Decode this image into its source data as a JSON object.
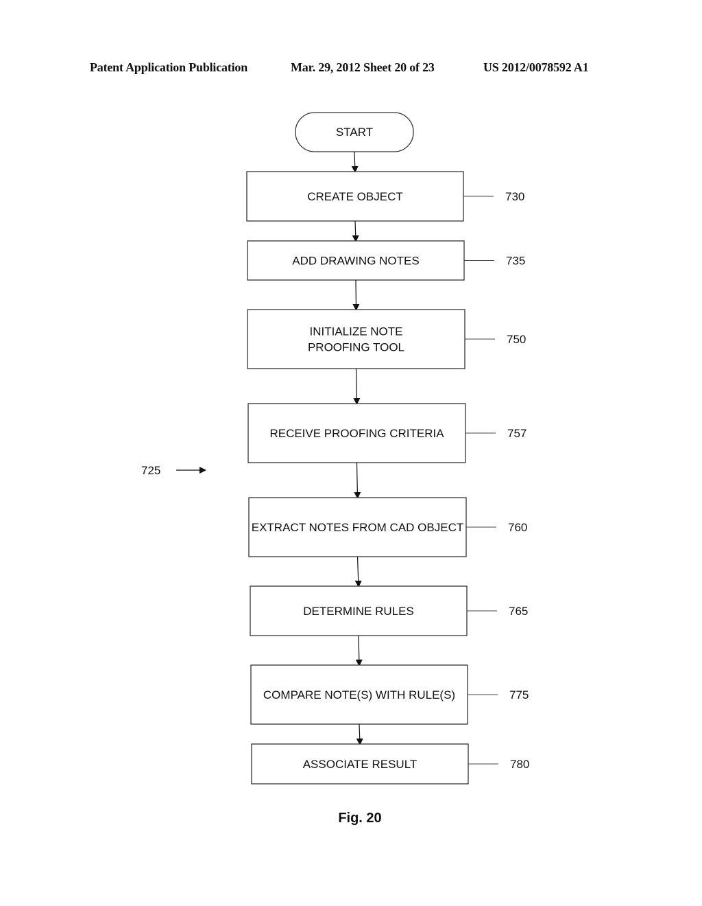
{
  "header": {
    "publication": "Patent Application Publication",
    "date_sheet": "Mar. 29, 2012  Sheet 20 of 23",
    "pub_number": "US 2012/0078592 A1"
  },
  "flowchart": {
    "start_label": "START",
    "steps": [
      {
        "lines": [
          "CREATE OBJECT"
        ],
        "ref": "730"
      },
      {
        "lines": [
          "ADD DRAWING NOTES"
        ],
        "ref": "735"
      },
      {
        "lines": [
          "INITIALIZE NOTE",
          "PROOFING TOOL"
        ],
        "ref": "750"
      },
      {
        "lines": [
          "RECEIVE PROOFING CRITERIA"
        ],
        "ref": "757"
      },
      {
        "lines": [
          "EXTRACT NOTES FROM CAD OBJECT"
        ],
        "ref": "760"
      },
      {
        "lines": [
          "DETERMINE RULES"
        ],
        "ref": "765"
      },
      {
        "lines": [
          "COMPARE NOTE(S) WITH RULE(S)"
        ],
        "ref": "775"
      },
      {
        "lines": [
          "ASSOCIATE RESULT"
        ],
        "ref": "780"
      }
    ],
    "process_ref": "725",
    "figure_label": "Fig. 20"
  }
}
